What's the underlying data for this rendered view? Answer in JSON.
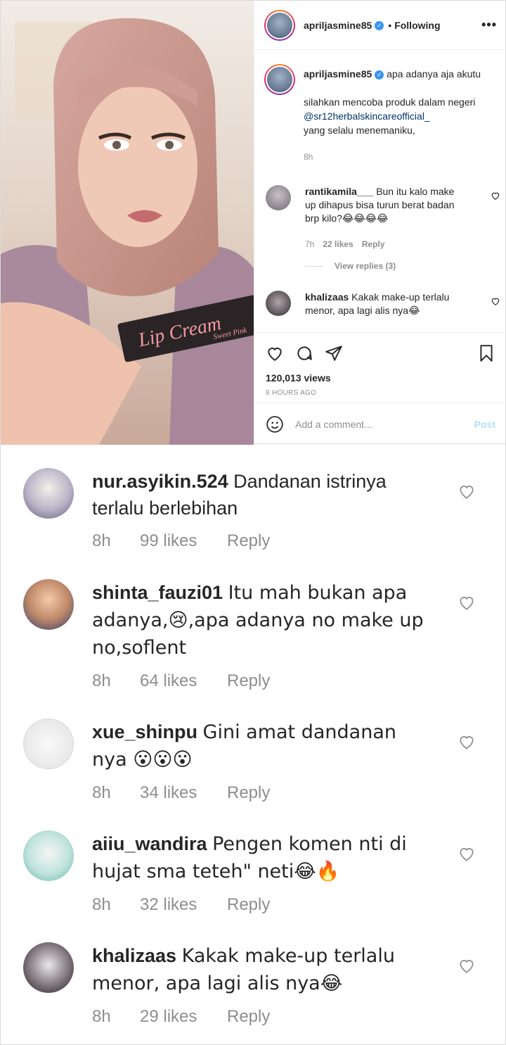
{
  "post": {
    "username": "apriljasmine85",
    "verified_icon": "verified-badge-icon",
    "dot": "•",
    "follow_status": "Following",
    "more_label": "•••",
    "caption_user": "apriljasmine85",
    "caption_line1": "apa adanya aja akutu",
    "caption_line2": "silahkan mencoba produk dalam negeri",
    "caption_mention": "@sr12herbalskincareofficial_",
    "caption_line3": "yang selalu menemaniku,",
    "caption_time": "8h",
    "product_text": "Lip Cream",
    "product_sub": "Sweet Pink",
    "views": "120,013 views",
    "ago": "8 HOURS AGO",
    "add_comment_placeholder": "Add a comment...",
    "post_button": "Post",
    "view_replies": "View replies (3)"
  },
  "side_comments": [
    {
      "user": "rantikamila___",
      "text": "Bun itu kalo make up dihapus bisa turun berat badan brp kilo?😂😂😂😂",
      "time": "7h",
      "likes": "22 likes",
      "reply": "Reply"
    },
    {
      "user": "khalizaas",
      "text": "Kakak make-up terlalu menor, apa lagi alis nya😂"
    }
  ],
  "comments": [
    {
      "user": "nur.asyikin.524",
      "text": "Dandanan istrinya terlalu berlebihan",
      "time": "8h",
      "likes": "99 likes",
      "reply": "Reply"
    },
    {
      "user": "shinta_fauzi01",
      "text": "Itu mah bukan apa adanya,😢,apa adanya no make up no,soflent",
      "time": "8h",
      "likes": "64 likes",
      "reply": "Reply"
    },
    {
      "user": "xue_shinpu",
      "text": "Gini amat dandanan nya 😮😮😮",
      "time": "8h",
      "likes": "34 likes",
      "reply": "Reply"
    },
    {
      "user": "aiiu_wandira",
      "text": "Pengen komen nti di hujat sma teteh\" neti😂🔥",
      "time": "8h",
      "likes": "32 likes",
      "reply": "Reply"
    },
    {
      "user": "khalizaas",
      "text": "Kakak make-up terlalu menor, apa lagi alis nya😂",
      "time": "8h",
      "likes": "29 likes",
      "reply": "Reply"
    }
  ],
  "colors": {
    "link": "#003569",
    "meta": "#8e8e8e",
    "post_btn": "#b2dffc",
    "verified": "#3897f0"
  }
}
